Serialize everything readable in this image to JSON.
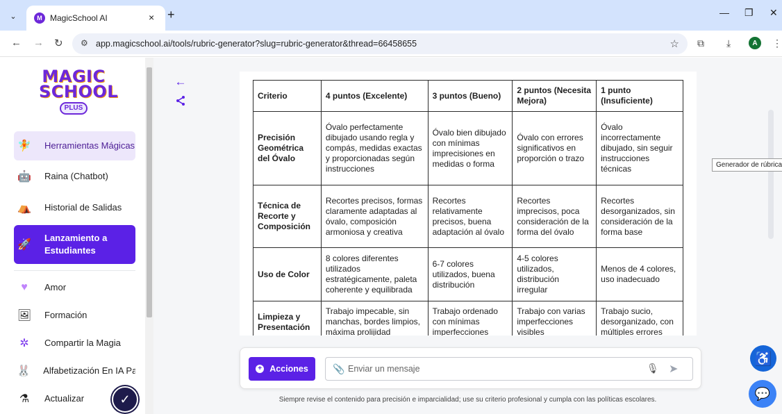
{
  "browser": {
    "tab_title": "MagicSchool AI",
    "tab_favicon": "M",
    "tab_close": "×",
    "new_tab": "+",
    "url": "app.magicschool.ai/tools/rubric-generator?slug=rubric-generator&thread=66458655",
    "profile_initial": "A",
    "icons": [
      "tab-list-icon",
      "back-icon",
      "forward-icon",
      "reload-icon",
      "site-info-icon",
      "star-icon",
      "extensions-icon",
      "downloads-icon",
      "menu-icon",
      "minimize-icon",
      "restore-icon",
      "close-icon"
    ]
  },
  "sidebar": {
    "logo": [
      "MAGIC",
      "SCHOOL"
    ],
    "logo_badge": "PLUS",
    "items": [
      {
        "label": "Herramientas Mágicas",
        "icon": "magic-tools-icon"
      },
      {
        "label": "Raina (Chatbot)",
        "icon": "robot-icon"
      },
      {
        "label": "Historial de Salidas",
        "icon": "history-icon"
      },
      {
        "label": "Lanzamiento a Estudiantes",
        "icon": "rocket-icon"
      },
      {
        "label": "Amor",
        "icon": "heart-icon"
      },
      {
        "label": "Formación",
        "icon": "easel-icon"
      },
      {
        "label": "Compartir la Magia",
        "icon": "share-magic-icon"
      },
      {
        "label": "Alfabetización En IA Para E",
        "icon": "bunny-icon"
      },
      {
        "label": "Actualizar",
        "icon": "potion-icon"
      }
    ]
  },
  "rubric": {
    "headers": [
      "Criterio",
      "4 puntos (Excelente)",
      "3 puntos (Bueno)",
      "2 puntos (Necesita Mejora)",
      "1 punto (Insuficiente)"
    ],
    "rows": [
      [
        "Precisión Geométrica del Óvalo",
        "Óvalo perfectamente dibujado usando regla y compás, medidas exactas y proporcionadas según instrucciones",
        "Óvalo bien dibujado con mínimas imprecisiones en medidas o forma",
        "Óvalo con errores significativos en proporción o trazo",
        "Óvalo incorrectamente dibujado, sin seguir instrucciones técnicas"
      ],
      [
        "Técnica de Recorte y Composición",
        "Recortes precisos, formas claramente adaptadas al óvalo, composición armoniosa y creativa",
        "Recortes relativamente precisos, buena adaptación al óvalo",
        "Recortes imprecisos, poca consideración de la forma del óvalo",
        "Recortes desorganizados, sin consideración de la forma base"
      ],
      [
        "Uso de Color",
        "8 colores diferentes utilizados estratégicamente, paleta coherente y equilibrada",
        "6-7 colores utilizados, buena distribución",
        "4-5 colores utilizados, distribución irregular",
        "Menos de 4 colores, uso inadecuado"
      ],
      [
        "Limpieza y Presentación",
        "Trabajo impecable, sin manchas, bordes limpios, máxima prolijidad",
        "Trabajo ordenado con mínimas imperfecciones",
        "Trabajo con varias imperfecciones visibles",
        "Trabajo sucio, desorganizado, con múltiples errores"
      ]
    ]
  },
  "chat": {
    "actions_label": "Acciones",
    "placeholder": "Enviar un mensaje"
  },
  "disclaimer": "Siempre revise el contenido para precisión e imparcialidad; use su criterio profesional y cumpla con las políticas escolares.",
  "tooltip": "Generador de rúbricas",
  "colors": {
    "brand_purple": "#5b21e6",
    "tabbar_blue": "#d3e3fd",
    "active_nav_bg": "#ede7fb"
  }
}
